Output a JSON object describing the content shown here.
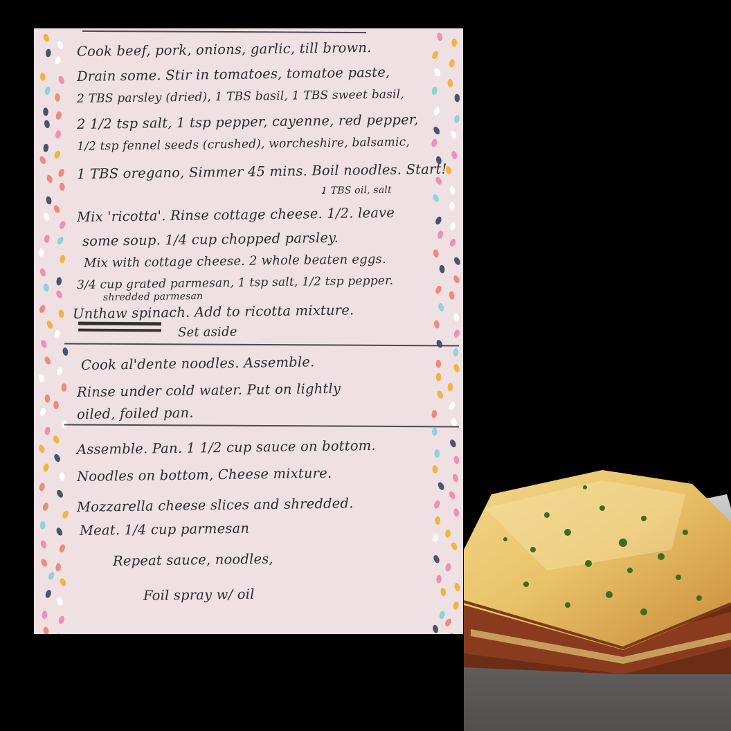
{
  "recipe_card": {
    "lines": [
      "Cook beef, pork, onions, garlic, till brown.",
      "Drain some. Stir in tomatoes, tomatoe paste,",
      "2 TBS parsley (dried), 1 TBS basil, 1 TBS sweet basil,",
      "2 1/2 tsp salt, 1 tsp pepper, cayenne, red pepper,",
      "1/2 tsp fennel seeds (crushed), worcheshire, balsamic,",
      "1 TBS oregano, Simmer 45 mins. Boil noodles. Start!",
      "1 TBS oil, salt",
      "Mix 'ricotta'. Rinse cottage cheese. 1/2. leave",
      "some soup. 1/4 cup chopped parsley.",
      "Mix with cottage cheese. 2 whole beaten eggs.",
      "3/4 cup grated parmesan, 1 tsp salt, 1/2 tsp pepper.",
      "shredded parmesan",
      "Unthaw spinach. Add to ricotta mixture.",
      "Set aside",
      "Cook al'dente noodles. Assemble.",
      "Rinse under cold water. Put on lightly",
      "oiled, foiled pan.",
      "Assemble. Pan. 1 1/2 cup sauce on bottom.",
      "Noodles on bottom, Cheese mixture.",
      "Mozzarella cheese slices and shredded.",
      "Meat. 1/4 cup parmesan",
      "Repeat sauce, noodles,",
      "Foil spray w/ oil"
    ],
    "dot_colors": [
      "#f08a7a",
      "#f2b341",
      "#4a5568",
      "#8fd3d6",
      "#ef8fb8",
      "#ffffff"
    ]
  },
  "photo": {
    "subject": "baked lasagna with melted cheese and chopped parsley in a foil-lined glass dish"
  }
}
